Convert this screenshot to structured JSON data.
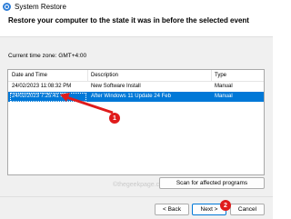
{
  "window": {
    "title": "System Restore",
    "icon": "system-restore-icon"
  },
  "header": {
    "heading": "Restore your computer to the state it was in before the selected event"
  },
  "timezone_label": "Current time zone: GMT+4:00",
  "table": {
    "columns": [
      "Date and Time",
      "Description",
      "Type"
    ],
    "rows": [
      {
        "date": "24/02/2023 11:08:32 PM",
        "description": "New Software Install",
        "type": "Manual",
        "selected": false
      },
      {
        "date": "24/02/2023 7:25:41 PM",
        "description": "After Windows 11 Update 24 Feb",
        "type": "Manual",
        "selected": true
      }
    ]
  },
  "watermark": "©thegeekpage.com",
  "annotations": {
    "step1": "1",
    "step2": "2",
    "marker_color": "#e01b1b"
  },
  "buttons": {
    "scan": "Scan for affected programs",
    "back": "< Back",
    "next": "Next >",
    "cancel": "Cancel"
  },
  "colors": {
    "selection": "#0078d7",
    "accent": "#2f7fd8"
  }
}
